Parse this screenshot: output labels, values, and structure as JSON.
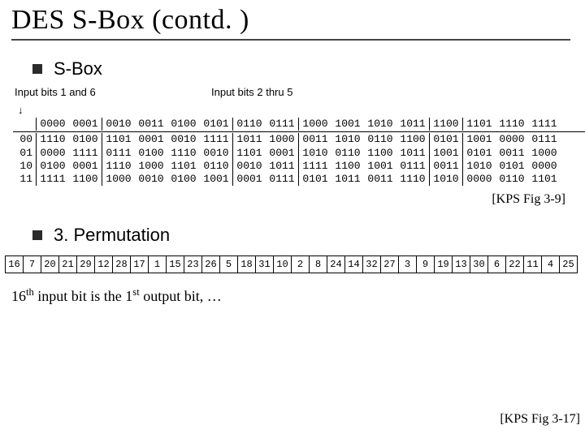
{
  "title": "DES S-Box (contd. )",
  "bullets": {
    "sbox": "S-Box",
    "perm": "3. Permutation"
  },
  "labels": {
    "left": "Input bits 1 and 6",
    "right": "Input bits 2 thru 5",
    "arrow": "↓"
  },
  "sbox_header": [
    "0000",
    "0001",
    "0010",
    "0011",
    "0100",
    "0101",
    "0110",
    "0111",
    "1000",
    "1001",
    "1010",
    "1011",
    "1100",
    "1101",
    "1110",
    "1111"
  ],
  "sbox_rows": [
    {
      "k": "00",
      "v": [
        "1110",
        "0100",
        "1101",
        "0001",
        "0010",
        "1111",
        "1011",
        "1000",
        "0011",
        "1010",
        "0110",
        "1100",
        "0101",
        "1001",
        "0000",
        "0111"
      ]
    },
    {
      "k": "01",
      "v": [
        "0000",
        "1111",
        "0111",
        "0100",
        "1110",
        "0010",
        "1101",
        "0001",
        "1010",
        "0110",
        "1100",
        "1011",
        "1001",
        "0101",
        "0011",
        "1000"
      ]
    },
    {
      "k": "10",
      "v": [
        "0100",
        "0001",
        "1110",
        "1000",
        "1101",
        "0110",
        "0010",
        "1011",
        "1111",
        "1100",
        "1001",
        "0111",
        "0011",
        "1010",
        "0101",
        "0000"
      ]
    },
    {
      "k": "11",
      "v": [
        "1111",
        "1100",
        "1000",
        "0010",
        "0100",
        "1001",
        "0001",
        "0111",
        "0101",
        "1011",
        "0011",
        "1110",
        "1010",
        "0000",
        "0110",
        "1101"
      ]
    }
  ],
  "ref_sbox": "[KPS Fig 3-9]",
  "perm": [
    "16",
    "7",
    "20",
    "21",
    "29",
    "12",
    "28",
    "17",
    "1",
    "15",
    "23",
    "26",
    "5",
    "18",
    "31",
    "10",
    "2",
    "8",
    "24",
    "14",
    "32",
    "27",
    "3",
    "9",
    "19",
    "13",
    "30",
    "6",
    "22",
    "11",
    "4",
    "25"
  ],
  "caption_a": "16",
  "caption_b": " input bit is the 1",
  "caption_c": " output bit, …",
  "sup_th": "th",
  "sup_st": "st",
  "ref_perm": "[KPS Fig 3-17]",
  "chart_data": {
    "type": "table",
    "title": "DES S-Box S1 (4-bit output for 6-bit input: rows = bits 1&6, cols = bits 2–5)",
    "columns": [
      "0000",
      "0001",
      "0010",
      "0011",
      "0100",
      "0101",
      "0110",
      "0111",
      "1000",
      "1001",
      "1010",
      "1011",
      "1100",
      "1101",
      "1110",
      "1111"
    ],
    "rows": {
      "00": [
        14,
        4,
        13,
        1,
        2,
        15,
        11,
        8,
        3,
        10,
        6,
        12,
        5,
        9,
        0,
        7
      ],
      "01": [
        0,
        15,
        7,
        4,
        14,
        2,
        13,
        1,
        10,
        6,
        12,
        11,
        9,
        5,
        3,
        8
      ],
      "10": [
        4,
        1,
        14,
        8,
        13,
        6,
        2,
        11,
        15,
        12,
        9,
        7,
        3,
        10,
        5,
        0
      ],
      "11": [
        15,
        12,
        8,
        2,
        4,
        9,
        1,
        7,
        5,
        11,
        3,
        14,
        10,
        0,
        6,
        13
      ]
    },
    "permutation_P": [
      16,
      7,
      20,
      21,
      29,
      12,
      28,
      17,
      1,
      15,
      23,
      26,
      5,
      18,
      31,
      10,
      2,
      8,
      24,
      14,
      32,
      27,
      3,
      9,
      19,
      13,
      30,
      6,
      22,
      11,
      4,
      25
    ]
  }
}
